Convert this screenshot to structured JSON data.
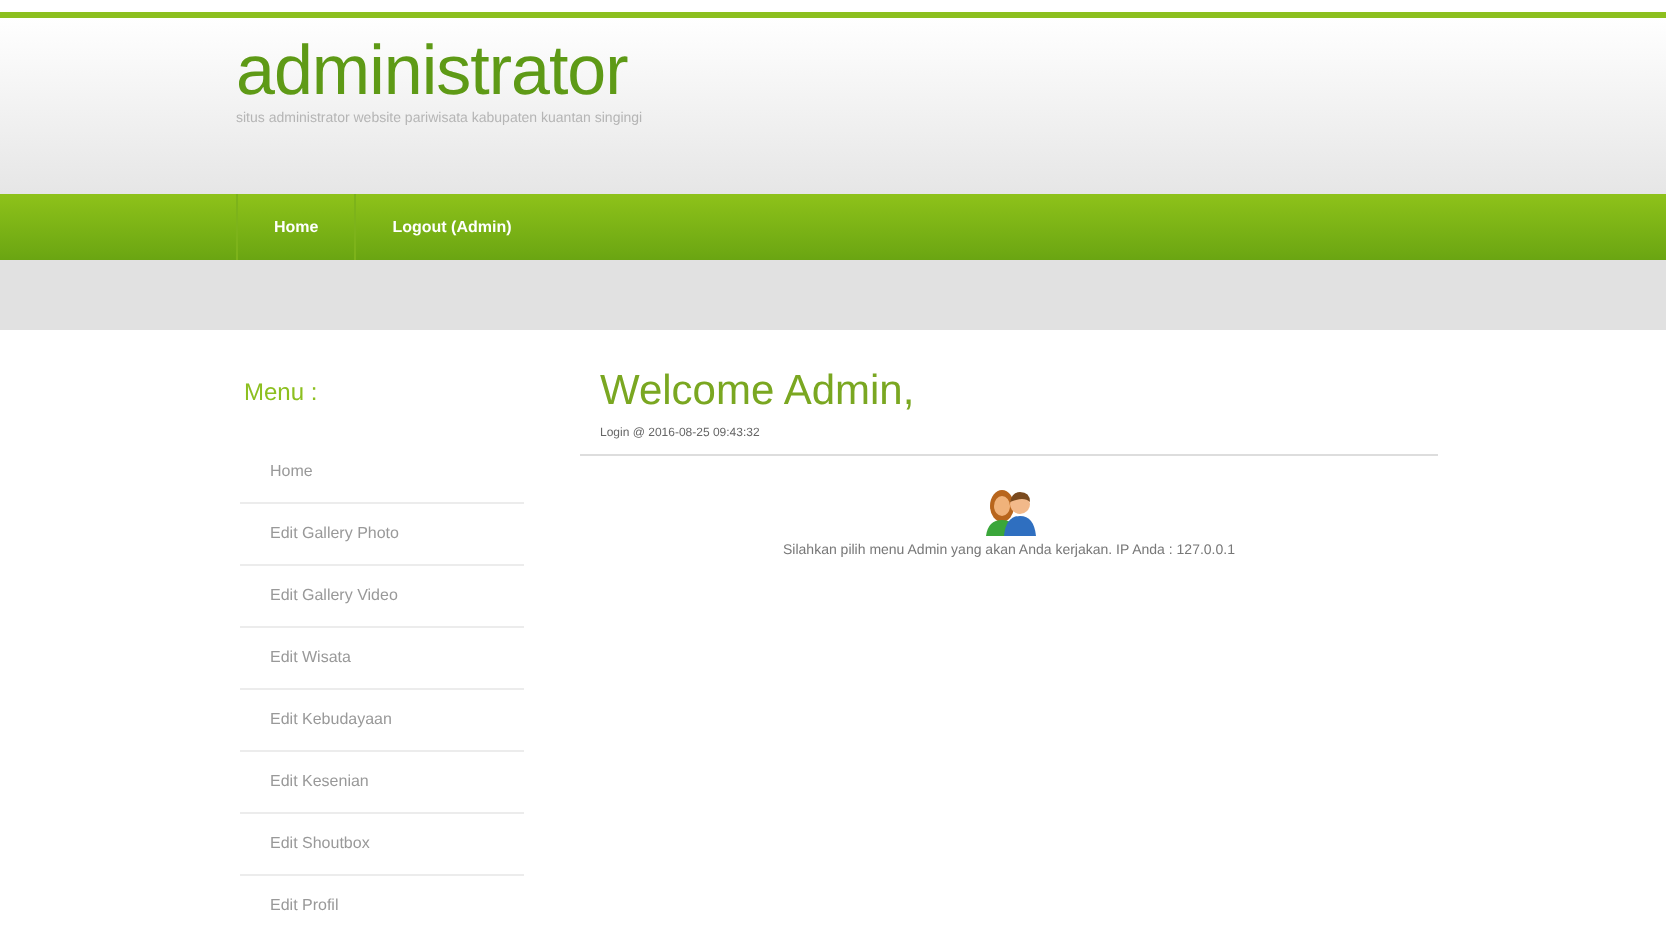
{
  "header": {
    "title": "administrator",
    "subtitle": "situs administrator website pariwisata kabupaten kuantan singingi"
  },
  "nav": [
    {
      "label": "Home"
    },
    {
      "label": "Logout (Admin)"
    }
  ],
  "sidebar": {
    "title": "Menu :",
    "items": [
      {
        "label": "Home"
      },
      {
        "label": "Edit Gallery Photo"
      },
      {
        "label": "Edit Gallery Video"
      },
      {
        "label": "Edit Wisata"
      },
      {
        "label": "Edit Kebudayaan"
      },
      {
        "label": "Edit Kesenian"
      },
      {
        "label": "Edit Shoutbox"
      },
      {
        "label": "Edit Profil"
      }
    ]
  },
  "main": {
    "heading": "Welcome Admin,",
    "login": "Login @ 2016-08-25 09:43:32",
    "message": "Silahkan pilih menu Admin yang akan Anda kerjakan. IP Anda : 127.0.0.1"
  }
}
